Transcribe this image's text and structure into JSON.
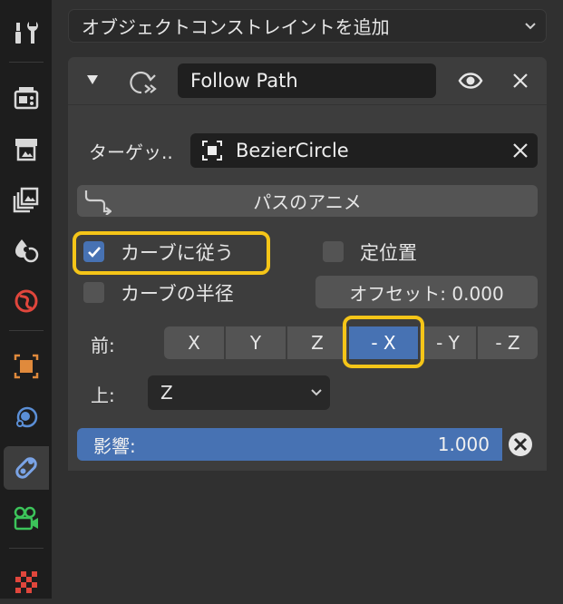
{
  "tabs": [
    {
      "name": "tool-wrench-icon",
      "active": false
    },
    {
      "name": "render-camera-icon",
      "active": false
    },
    {
      "name": "output-printer-icon",
      "active": false
    },
    {
      "name": "view-layer-icon",
      "active": false
    },
    {
      "name": "scene-icon",
      "active": false
    },
    {
      "name": "world-icon",
      "active": false
    },
    {
      "name": "object-icon",
      "active": false
    },
    {
      "name": "physics-icon",
      "active": false
    },
    {
      "name": "constraints-icon",
      "active": true
    },
    {
      "name": "object-data-icon",
      "active": false
    },
    {
      "name": "texture-icon",
      "active": false
    }
  ],
  "add_constraint": {
    "label": "オブジェクトコンストレイントを追加"
  },
  "constraint": {
    "name": "Follow Path",
    "target_label": "ターゲッ..",
    "target_value": "BezierCircle",
    "animate_path_label": "パスのアニメ",
    "follow_curve_label": "カーブに従う",
    "follow_curve_checked": true,
    "fixed_position_label": "定位置",
    "fixed_position_checked": false,
    "curve_radius_label": "カーブの半径",
    "curve_radius_checked": false,
    "offset_text": "オフセット: 0.000",
    "forward_label": "前:",
    "forward_axes": [
      "X",
      "Y",
      "Z",
      "- X",
      "- Y",
      "- Z"
    ],
    "forward_selected": "- X",
    "up_label": "上:",
    "up_value": "Z",
    "influence_label": "影響:",
    "influence_value": "1.000"
  },
  "colors": {
    "accent": "#4772b3",
    "highlight": "#f5c518",
    "panel": "#3d3d3d",
    "background": "#303030"
  }
}
